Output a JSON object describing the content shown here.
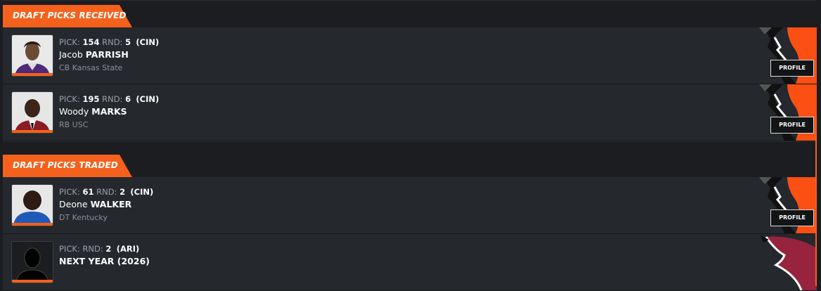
{
  "sections": [
    {
      "title": "DRAFT PICKS RECEIVED",
      "picks": [
        {
          "pick_label": "PICK:",
          "pick": "154",
          "rnd_label": "RND:",
          "rnd": "5",
          "team": "(CIN)",
          "first": "Jacob",
          "last": "PARRISH",
          "info": "CB Kansas State",
          "profile": "PROFILE",
          "team_logo": "bengals-logo"
        },
        {
          "pick_label": "PICK:",
          "pick": "195",
          "rnd_label": "RND:",
          "rnd": "6",
          "team": "(CIN)",
          "first": "Woody",
          "last": "MARKS",
          "info": "RB USC",
          "profile": "PROFILE",
          "team_logo": "bengals-logo"
        }
      ]
    },
    {
      "title": "DRAFT PICKS TRADED",
      "picks": [
        {
          "pick_label": "PICK:",
          "pick": "61",
          "rnd_label": "RND:",
          "rnd": "2",
          "team": "(CIN)",
          "first": "Deone",
          "last": "WALKER",
          "info": "DT Kentucky",
          "profile": "PROFILE",
          "team_logo": "bengals-logo"
        },
        {
          "pick_label": "PICK:",
          "pick": "",
          "rnd_label": "RND:",
          "rnd": "2",
          "team": "(ARI)",
          "first": "",
          "last": "NEXT YEAR (2026)",
          "info": "",
          "profile": "",
          "team_logo": "cardinals-logo"
        }
      ]
    }
  ],
  "colors": {
    "accent": "#f4611c",
    "bengals_orange": "#fb4f14",
    "cardinals_red": "#97233f"
  }
}
